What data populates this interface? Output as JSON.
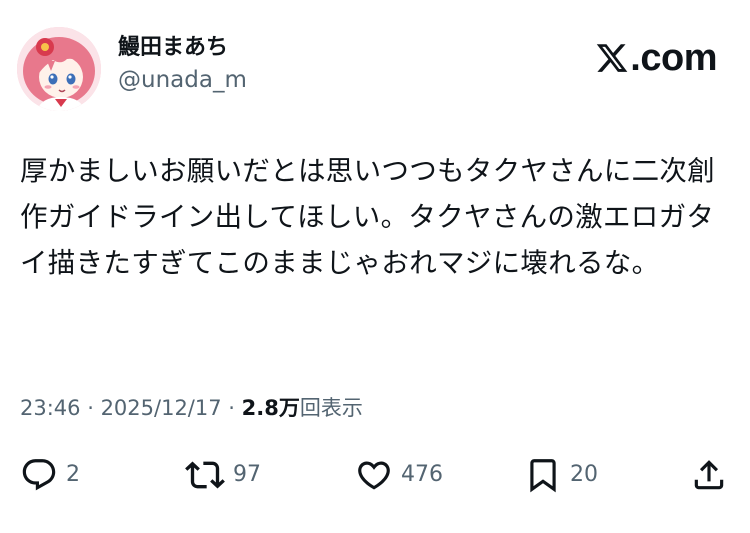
{
  "author": {
    "display_name": "鰻田まあち",
    "handle": "@unada_m"
  },
  "brand": {
    "site": ".com",
    "accent": "#0f1419"
  },
  "tweet": {
    "text": "厚かましいお願いだとは思いつつもタクヤさんに二次創作ガイドライン出してほしい。タクヤさんの激エロガタイ描きたすぎてこのままじゃおれマジに壊れるな。",
    "time": "23:46",
    "separator": " · ",
    "date": "2025/12/17",
    "views_count": "2.8万",
    "views_label": "回表示"
  },
  "actions": {
    "replies": "2",
    "reposts": "97",
    "likes": "476",
    "bookmarks": "20"
  },
  "icons": {
    "reply": "reply-icon",
    "repost": "repost-icon",
    "like": "heart-icon",
    "bookmark": "bookmark-icon",
    "share": "share-icon"
  },
  "colors": {
    "text_primary": "#0f1419",
    "text_secondary": "#536471",
    "avatar_hair": "#e8788c",
    "avatar_bg": "#f7c9d4"
  }
}
